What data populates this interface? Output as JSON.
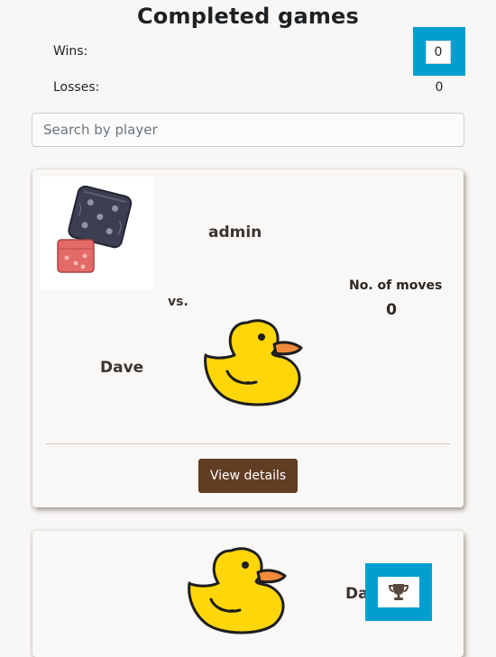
{
  "page": {
    "title": "Completed games"
  },
  "stats": {
    "wins_label": "Wins:",
    "wins_value": "0",
    "losses_label": "Losses:",
    "losses_value": "0"
  },
  "search": {
    "placeholder": "Search by player",
    "value": ""
  },
  "games": [
    {
      "player_top": "admin",
      "vs_label": "vs.",
      "player_bottom": "Dave",
      "moves_label": "No. of moves",
      "moves_value": "0",
      "details_label": "View details",
      "thumbnail_icon": "dice-icon",
      "avatar_icon": "rubber-duck-icon"
    },
    {
      "player": "Dave",
      "avatar_icon": "rubber-duck-icon",
      "winner_icon": "trophy-icon"
    }
  ],
  "colors": {
    "accent_highlight": "#009fd0",
    "button_brown": "#613d24",
    "duck_yellow": "#ffd60a",
    "duck_beak": "#f28a3c"
  }
}
